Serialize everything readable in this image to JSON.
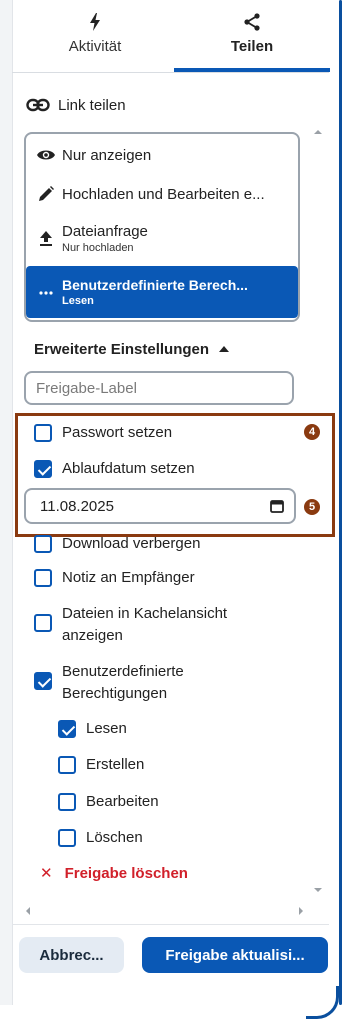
{
  "tabs": {
    "activity": {
      "label": "Aktivität",
      "icon": "lightning-icon"
    },
    "share": {
      "label": "Teilen",
      "icon": "share-icon"
    }
  },
  "link_share": {
    "label": "Link teilen",
    "icon": "link-icon"
  },
  "permissions": {
    "options": [
      {
        "label": "Nur anzeigen",
        "icon": "eye-icon"
      },
      {
        "label": "Hochladen und Bearbeiten e...",
        "icon": "pencil-icon"
      },
      {
        "label": "Dateianfrage",
        "sublabel": "Nur hochladen",
        "icon": "upload-icon"
      },
      {
        "label": "Benutzerdefinierte Berech...",
        "sublabel": "Lesen",
        "icon": "more-icon",
        "selected": true
      }
    ]
  },
  "advanced": {
    "label": "Erweiterte Einstellungen"
  },
  "share_label_input": {
    "placeholder": "Freigabe-Label",
    "value": ""
  },
  "settings": {
    "password": {
      "label": "Passwort setzen",
      "checked": false
    },
    "expiry": {
      "label": "Ablaufdatum setzen",
      "checked": true
    },
    "expiry_date": "11.08.2025",
    "hide_download": {
      "label": "Download verbergen",
      "checked": false
    },
    "note": {
      "label": "Notiz an Empfänger",
      "checked": false
    },
    "grid_view": {
      "label": "Dateien in Kachelansicht anzeigen",
      "checked": false
    },
    "custom_perms": {
      "label": "Benutzerdefinierte Berechtigungen",
      "checked": true
    },
    "read": {
      "label": "Lesen",
      "checked": true
    },
    "create": {
      "label": "Erstellen",
      "checked": false
    },
    "edit": {
      "label": "Bearbeiten",
      "checked": false
    },
    "delete": {
      "label": "Löschen",
      "checked": false
    }
  },
  "annotations": {
    "badge4": "4",
    "badge5": "5"
  },
  "delete_share": {
    "label": "Freigabe löschen"
  },
  "footer": {
    "cancel": "Abbrec...",
    "update": "Freigabe aktualisi..."
  },
  "colors": {
    "accent": "#0a58b5",
    "danger": "#d1202a",
    "highlight": "#8a3a10"
  }
}
